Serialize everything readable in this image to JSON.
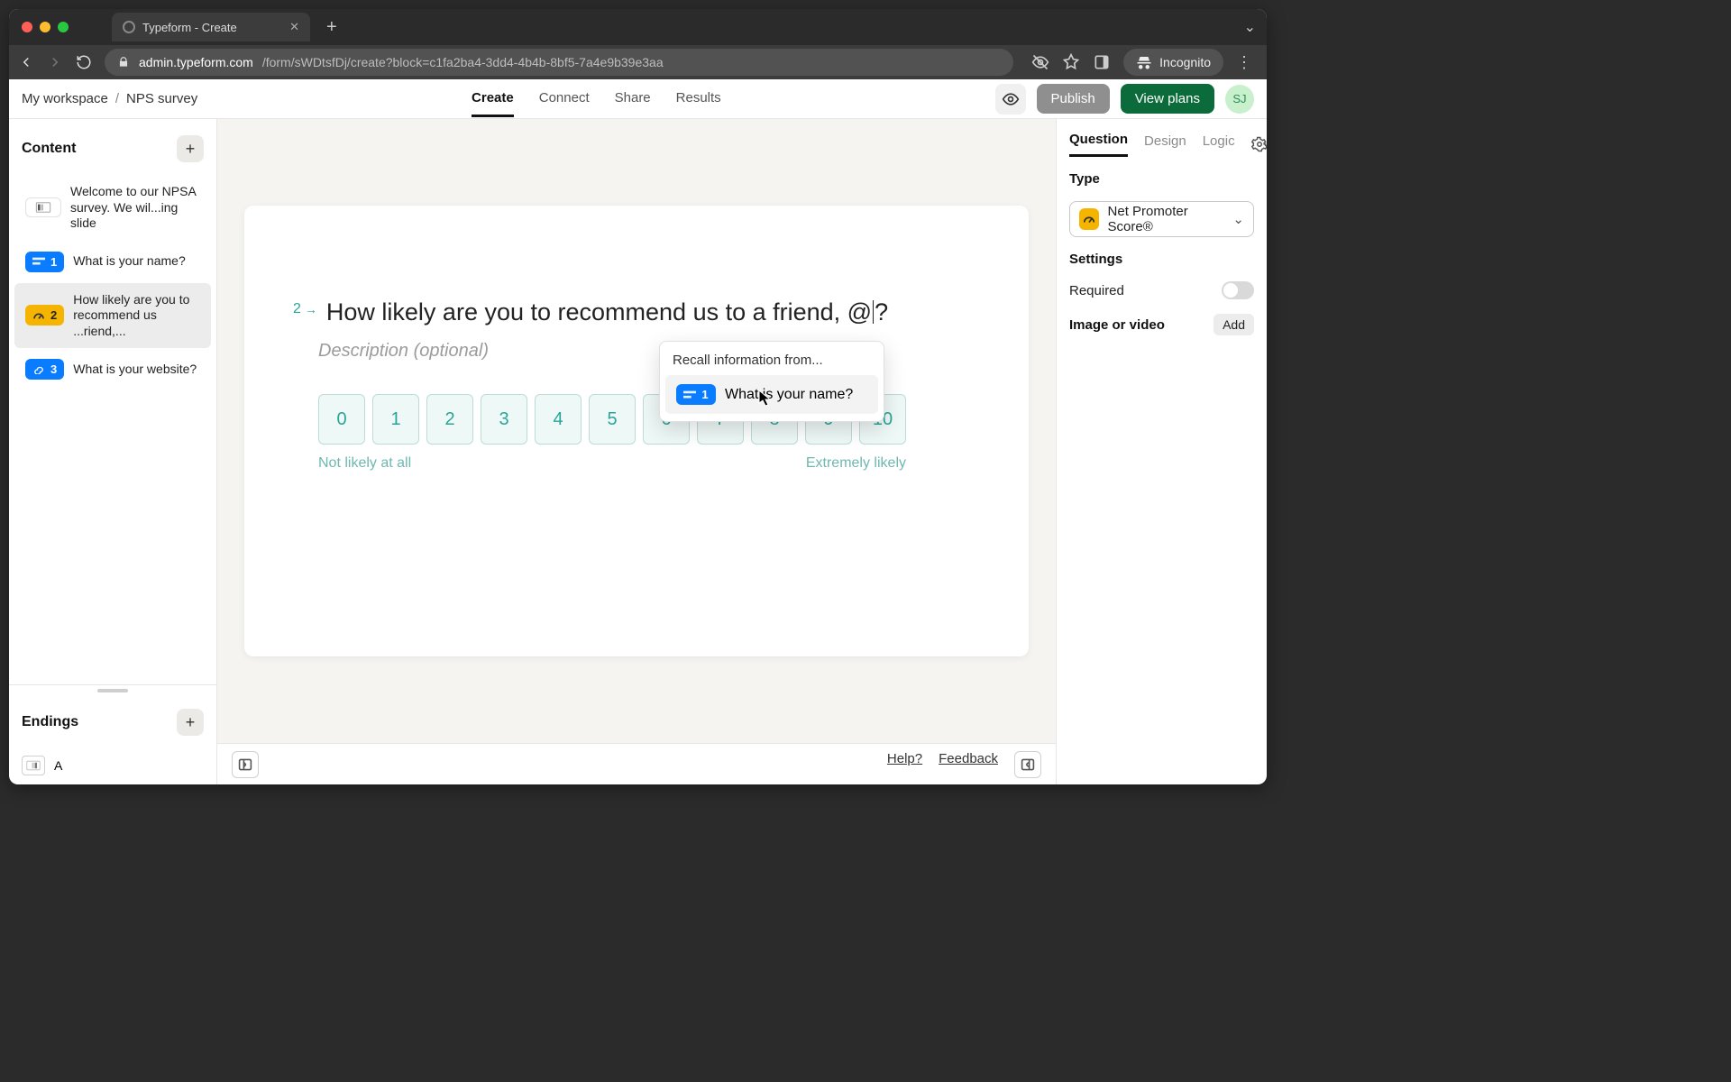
{
  "browser": {
    "tab_title": "Typeform - Create",
    "url_host": "admin.typeform.com",
    "url_path": "/form/sWDtsfDj/create?block=c1fa2ba4-3dd4-4b4b-8bf5-7a4e9b39e3aa",
    "incognito_label": "Incognito"
  },
  "appbar": {
    "workspace": "My workspace",
    "separator": "/",
    "form_name": "NPS survey",
    "tabs": [
      "Create",
      "Connect",
      "Share",
      "Results"
    ],
    "publish": "Publish",
    "view_plans": "View plans",
    "avatar_initials": "SJ"
  },
  "sidebar": {
    "content_heading": "Content",
    "items": [
      {
        "badge_type": "white",
        "num": "",
        "text": "Welcome to our NPSA survey. We wil...ing slide"
      },
      {
        "badge_type": "blue",
        "num": "1",
        "text": "What is your name?"
      },
      {
        "badge_type": "yellow",
        "num": "2",
        "text": "How likely are you to recommend us ...riend,..."
      },
      {
        "badge_type": "blue",
        "num": "3",
        "text": "What is your website?"
      }
    ],
    "endings_heading": "Endings",
    "ending_label": "A"
  },
  "canvas": {
    "question_number": "2",
    "question_text_pre": "How likely are you to recommend us to a friend, ",
    "question_at": "@",
    "question_text_post": "?",
    "description_placeholder": "Description (optional)",
    "scale": [
      "0",
      "1",
      "2",
      "3",
      "4",
      "5",
      "6",
      "7",
      "8",
      "9",
      "10"
    ],
    "label_left": "Not likely at all",
    "label_right": "Extremely likely"
  },
  "recall": {
    "title": "Recall information from...",
    "option_num": "1",
    "option_text": "What is your name?"
  },
  "footer": {
    "help": "Help?",
    "feedback": "Feedback"
  },
  "rightpanel": {
    "tabs": [
      "Question",
      "Design",
      "Logic"
    ],
    "type_label": "Type",
    "type_value": "Net Promoter Score®",
    "settings_label": "Settings",
    "required_label": "Required",
    "media_label": "Image or video",
    "add_label": "Add"
  }
}
